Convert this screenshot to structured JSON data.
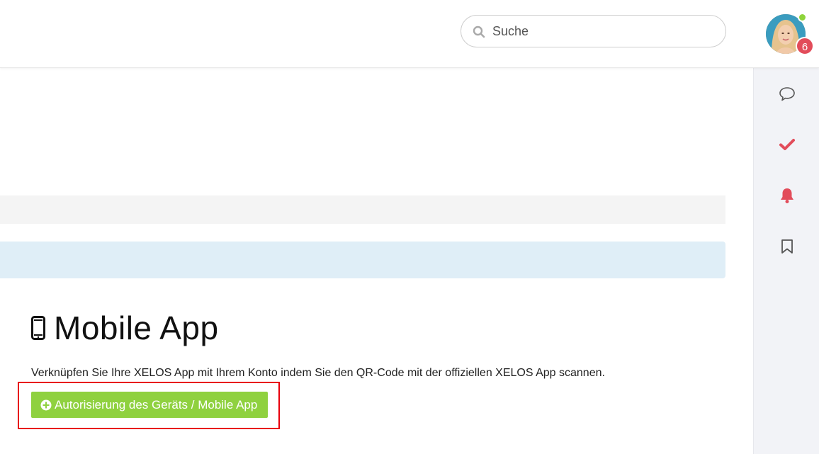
{
  "header": {
    "search": {
      "placeholder": "Suche",
      "value": ""
    },
    "user": {
      "notification_count": "6",
      "online": true
    }
  },
  "rail": {
    "items": [
      {
        "icon": "chat-bubble-icon",
        "color": "#555555"
      },
      {
        "icon": "checkmark-icon",
        "color": "#e24c5a"
      },
      {
        "icon": "bell-icon",
        "color": "#e24c5a"
      },
      {
        "icon": "bookmark-icon",
        "color": "#555555"
      }
    ]
  },
  "main": {
    "title": "Mobile App",
    "title_icon": "mobile-phone-icon",
    "description": "Verknüpfen Sie Ihre XELOS App mit Ihrem Konto indem Sie den QR-Code mit der offiziellen XELOS App scannen.",
    "auth_button": {
      "label": "Autorisierung des Geräts / Mobile App",
      "icon": "plus-circle-icon",
      "color": "#8fd13f"
    }
  },
  "colors": {
    "accent_green": "#8fd13f",
    "badge_red": "#e24c5a",
    "highlight_red": "#e8000b",
    "info_blue": "#dfeef7"
  }
}
